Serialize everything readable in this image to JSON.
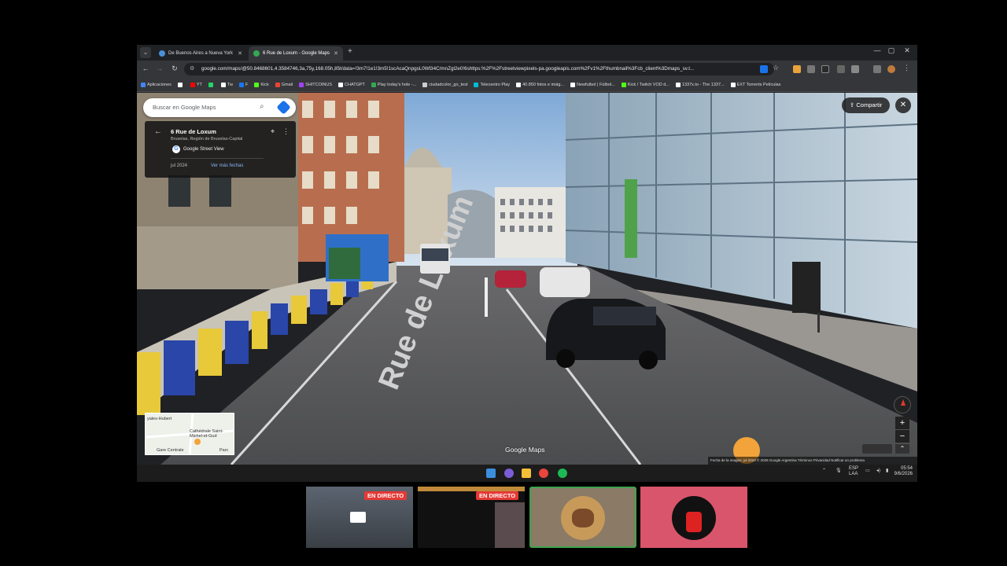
{
  "browser": {
    "tabs": [
      {
        "label": "De Buenos Aires a Nueva York"
      },
      {
        "label": "6 Rue de Loxum - Google Maps"
      }
    ],
    "new_tab_label": "+",
    "url": "google.com/maps/@50.8468601,4.3584746,3a,75y,168.05h,85t/data=!3m7!1e1!3m5!1scAcaQnpgsL0Wl34C/mnZgl2e0!6shttps:%2F%2Fstreetviewpixels-pa.googleapis.com%2Fv1%2Fthumbnail%3Fcb_client%3Dmaps_sv.t...",
    "window_controls": {
      "minimize": "—",
      "maximize": "▢",
      "close": "✕"
    }
  },
  "bookmarks": [
    {
      "label": "Aplicaciones",
      "color": "#4285f4"
    },
    {
      "label": "",
      "color": "#ffffff"
    },
    {
      "label": "YT",
      "color": "#ff0000"
    },
    {
      "label": "",
      "color": "#25d366"
    },
    {
      "label": "Tw",
      "color": "#ffffff"
    },
    {
      "label": "F",
      "color": "#1877f2"
    },
    {
      "label": "Kick",
      "color": "#53fc18"
    },
    {
      "label": "Gmail",
      "color": "#ea4335"
    },
    {
      "label": "SHITCOINUS",
      "color": "#a142f4"
    },
    {
      "label": "CHATGPT",
      "color": "#ffffff"
    },
    {
      "label": "Play today's hole -...",
      "color": "#34a853"
    },
    {
      "label": "ciudadcolor_go_test",
      "color": "#cccccc"
    },
    {
      "label": "Telecentro Play",
      "color": "#00bcd4"
    },
    {
      "label": "40.850 fotos e imág...",
      "color": "#ffffff"
    },
    {
      "label": "Newfutbol | Fútbol...",
      "color": "#ffffff"
    },
    {
      "label": "Kick / Twitch VOD d...",
      "color": "#53fc18"
    },
    {
      "label": "1337x.to - The 1337...",
      "color": "#ffffff"
    },
    {
      "label": "EXT Torrents Películas",
      "color": "#ffffff"
    }
  ],
  "maps": {
    "search_placeholder": "Buscar en Google Maps",
    "place_title": "6 Rue de Loxum",
    "place_subtitle": "Bruselas, Región de Bruselas-Capital",
    "source": "Google Street View",
    "capture_date": "jul 2024",
    "more_dates": "Ver más fechas",
    "share_label": "Compartir",
    "road_label": "Rue de Loxum",
    "logo": "Google Maps",
    "footer": "Fecha de la imagen: jul 2024   © 2026 Google   Argentina   Términos   Privacidad   Notificar un problema",
    "minimap_labels": [
      "yales-Hubert",
      "Cathédrale Saint-Michel-et-Gud",
      "Gare Centrale",
      "Parc"
    ],
    "zoom_in": "+",
    "zoom_out": "−",
    "expand": "⌃"
  },
  "taskbar": {
    "lang": "ESP",
    "lang2": "LAA",
    "time": "05:54",
    "date": "9/6/2026"
  },
  "call": {
    "live_label": "EN DIRECTO"
  }
}
